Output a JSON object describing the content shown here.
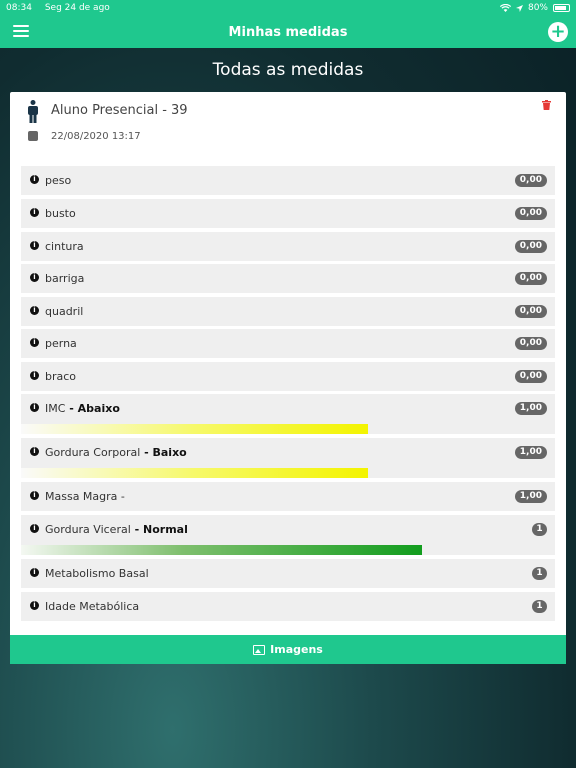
{
  "status_bar": {
    "time": "08:34",
    "date": "Seg 24 de ago",
    "battery": "80%"
  },
  "navbar": {
    "title": "Minhas medidas"
  },
  "page_title": "Todas as medidas",
  "card": {
    "student": "Aluno Presencial - 39",
    "date": "22/08/2020 13:17"
  },
  "measurements": [
    {
      "label": "peso",
      "value": "0,00"
    },
    {
      "label": "busto",
      "value": "0,00"
    },
    {
      "label": "cintura",
      "value": "0,00"
    },
    {
      "label": "barriga",
      "value": "0,00"
    },
    {
      "label": "quadril",
      "value": "0,00"
    },
    {
      "label": "perna",
      "value": "0,00"
    },
    {
      "label": "braco",
      "value": "0,00"
    },
    {
      "label": "IMC",
      "status": " - Abaixo",
      "value": "1,00"
    },
    {
      "label": "Gordura Corporal",
      "status": " - Baixo",
      "value": "1,00"
    },
    {
      "label": "Massa Magra -",
      "value": "1,00"
    },
    {
      "label": "Gordura Viceral",
      "status": " - Normal",
      "value": "1"
    },
    {
      "label": "Metabolismo Basal",
      "value": "1"
    },
    {
      "label": "Idade Metabólica",
      "value": "1"
    }
  ],
  "bars": {
    "imc_fill": 0.65,
    "gordura_corporal_fill": 0.65,
    "gordura_viceral_fill": 0.75
  },
  "colors": {
    "accent": "#1fc88e",
    "delete": "#e53935",
    "badge": "#666666",
    "yellow": "#f3f400",
    "green": "#129d1e"
  },
  "images_button": {
    "label": "Imagens"
  }
}
